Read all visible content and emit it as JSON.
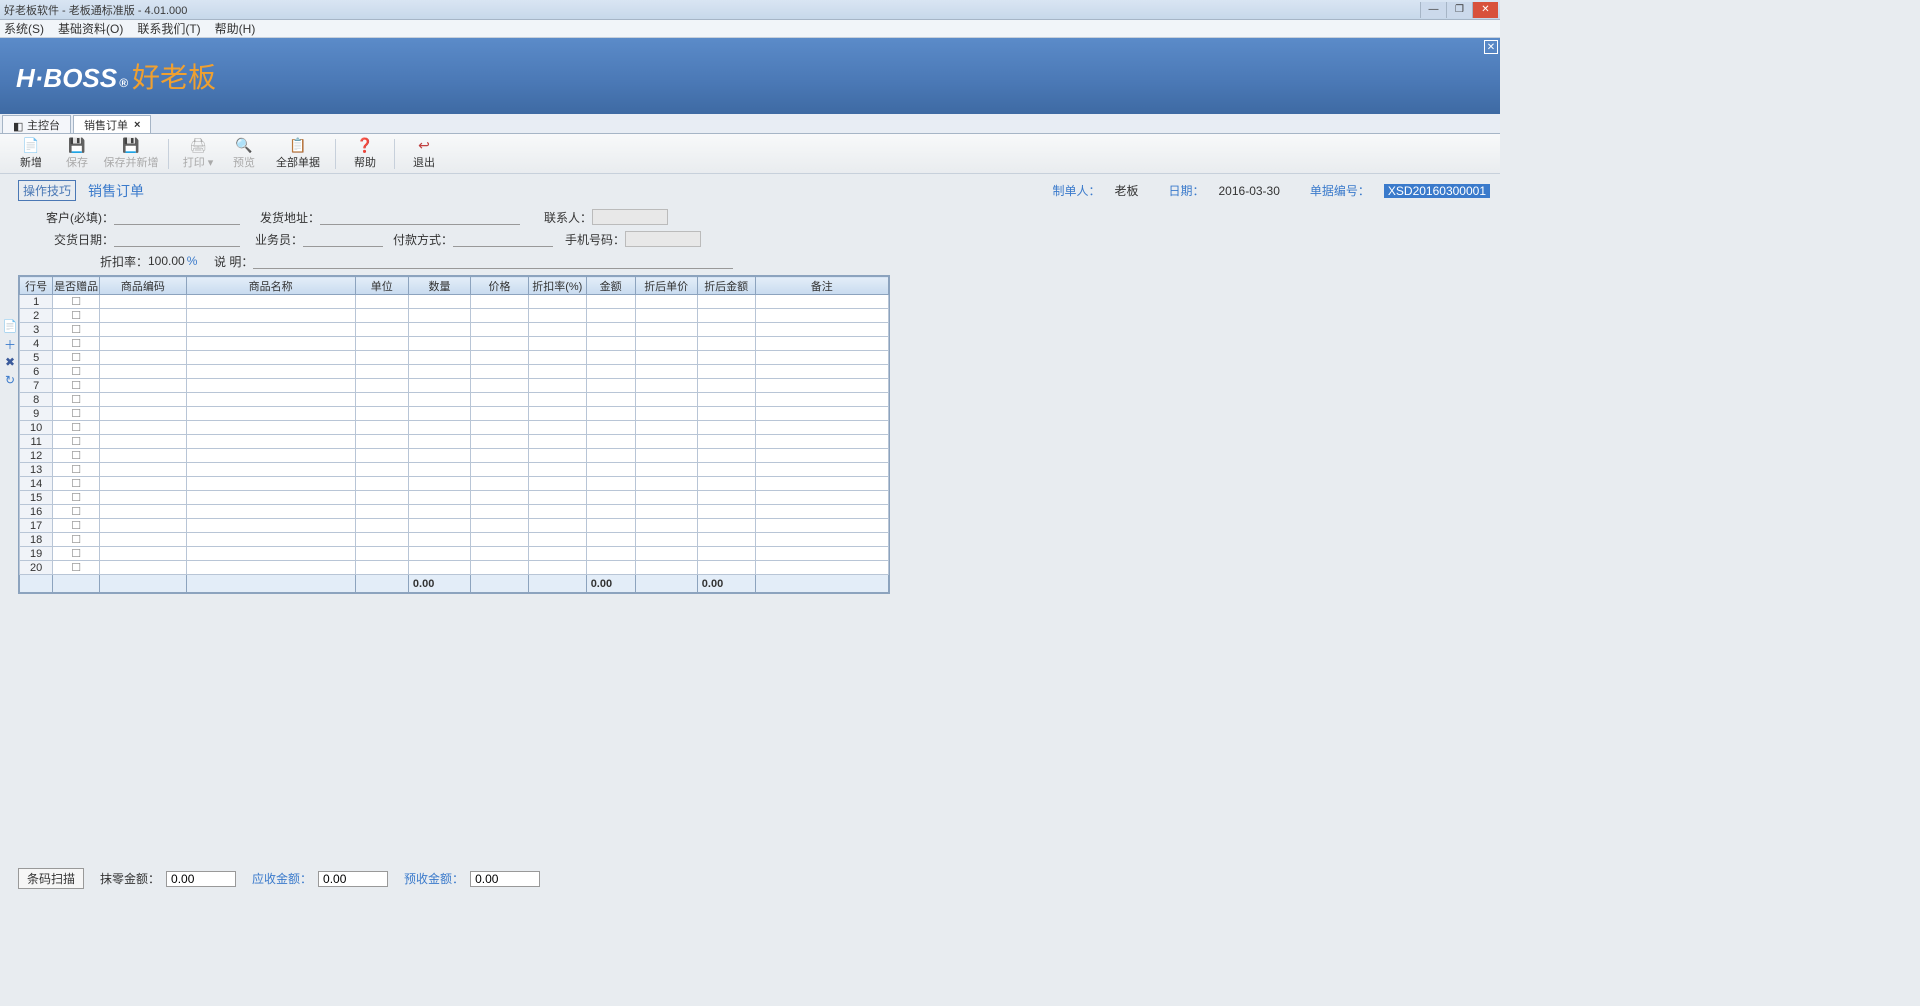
{
  "window": {
    "title": "好老板软件 - 老板通标准版 - 4.01.000",
    "min": "—",
    "max": "❐",
    "close": "✕"
  },
  "menubar": [
    "系统(S)",
    "基础资料(O)",
    "联系我们(T)",
    "帮助(H)"
  ],
  "logo": {
    "en": "H·BOSS",
    "reg": "®",
    "cn": "好老板"
  },
  "tabs": [
    {
      "label": "主控台",
      "active": false,
      "closable": false
    },
    {
      "label": "销售订单",
      "active": true,
      "closable": true
    }
  ],
  "toolbar": [
    {
      "icon": "📄",
      "label": "新增",
      "enabled": true,
      "color": "#5a9de0"
    },
    {
      "icon": "💾",
      "label": "保存",
      "enabled": false
    },
    {
      "icon": "💾",
      "label": "保存并新增",
      "enabled": false
    },
    {
      "sep": true
    },
    {
      "icon": "🖨",
      "label": "打印",
      "enabled": false,
      "dropdown": true
    },
    {
      "icon": "🔍",
      "label": "预览",
      "enabled": false
    },
    {
      "icon": "📋",
      "label": "全部单据",
      "enabled": true,
      "color": "#3a7acb"
    },
    {
      "sep": true
    },
    {
      "icon": "❓",
      "label": "帮助",
      "enabled": true,
      "color": "#d88c3a"
    },
    {
      "sep": true
    },
    {
      "icon": "↩",
      "label": "退出",
      "enabled": true,
      "color": "#c04040"
    }
  ],
  "doc": {
    "tips": "操作技巧",
    "title": "销售订单",
    "maker_label": "制单人：",
    "maker": "老板",
    "date_label": "日期：",
    "date": "2016-03-30",
    "no_label": "单据编号：",
    "no": "XSD20160300001"
  },
  "form": {
    "customer_label": "客户(必填)：",
    "addr_label": "发货地址：",
    "contact_label": "联系人：",
    "delivery_date_label": "交货日期：",
    "salesman_label": "业务员：",
    "payment_label": "付款方式：",
    "mobile_label": "手机号码：",
    "discount_label": "折扣率：",
    "discount_value": "100.00",
    "discount_unit": "%",
    "remark_label": "说 明："
  },
  "grid": {
    "columns": [
      "行号",
      "是否赠品",
      "商品编码",
      "商品名称",
      "单位",
      "数量",
      "价格",
      "折扣率(%)",
      "金额",
      "折后单价",
      "折后金额",
      "备注"
    ],
    "widths": [
      30,
      42,
      78,
      152,
      48,
      56,
      52,
      52,
      44,
      56,
      52,
      120
    ],
    "row_count": 20,
    "totals_qty": "0.00",
    "totals_amount": "0.00",
    "totals_discount_amount": "0.00"
  },
  "side": [
    "📄",
    "＋",
    "✖",
    "↻"
  ],
  "footer": {
    "scan_label": "条码扫描",
    "round_label": "抹零金额：",
    "round_val": "0.00",
    "receivable_label": "应收金额：",
    "receivable_val": "0.00",
    "prepaid_label": "预收金额：",
    "prepaid_val": "0.00"
  }
}
